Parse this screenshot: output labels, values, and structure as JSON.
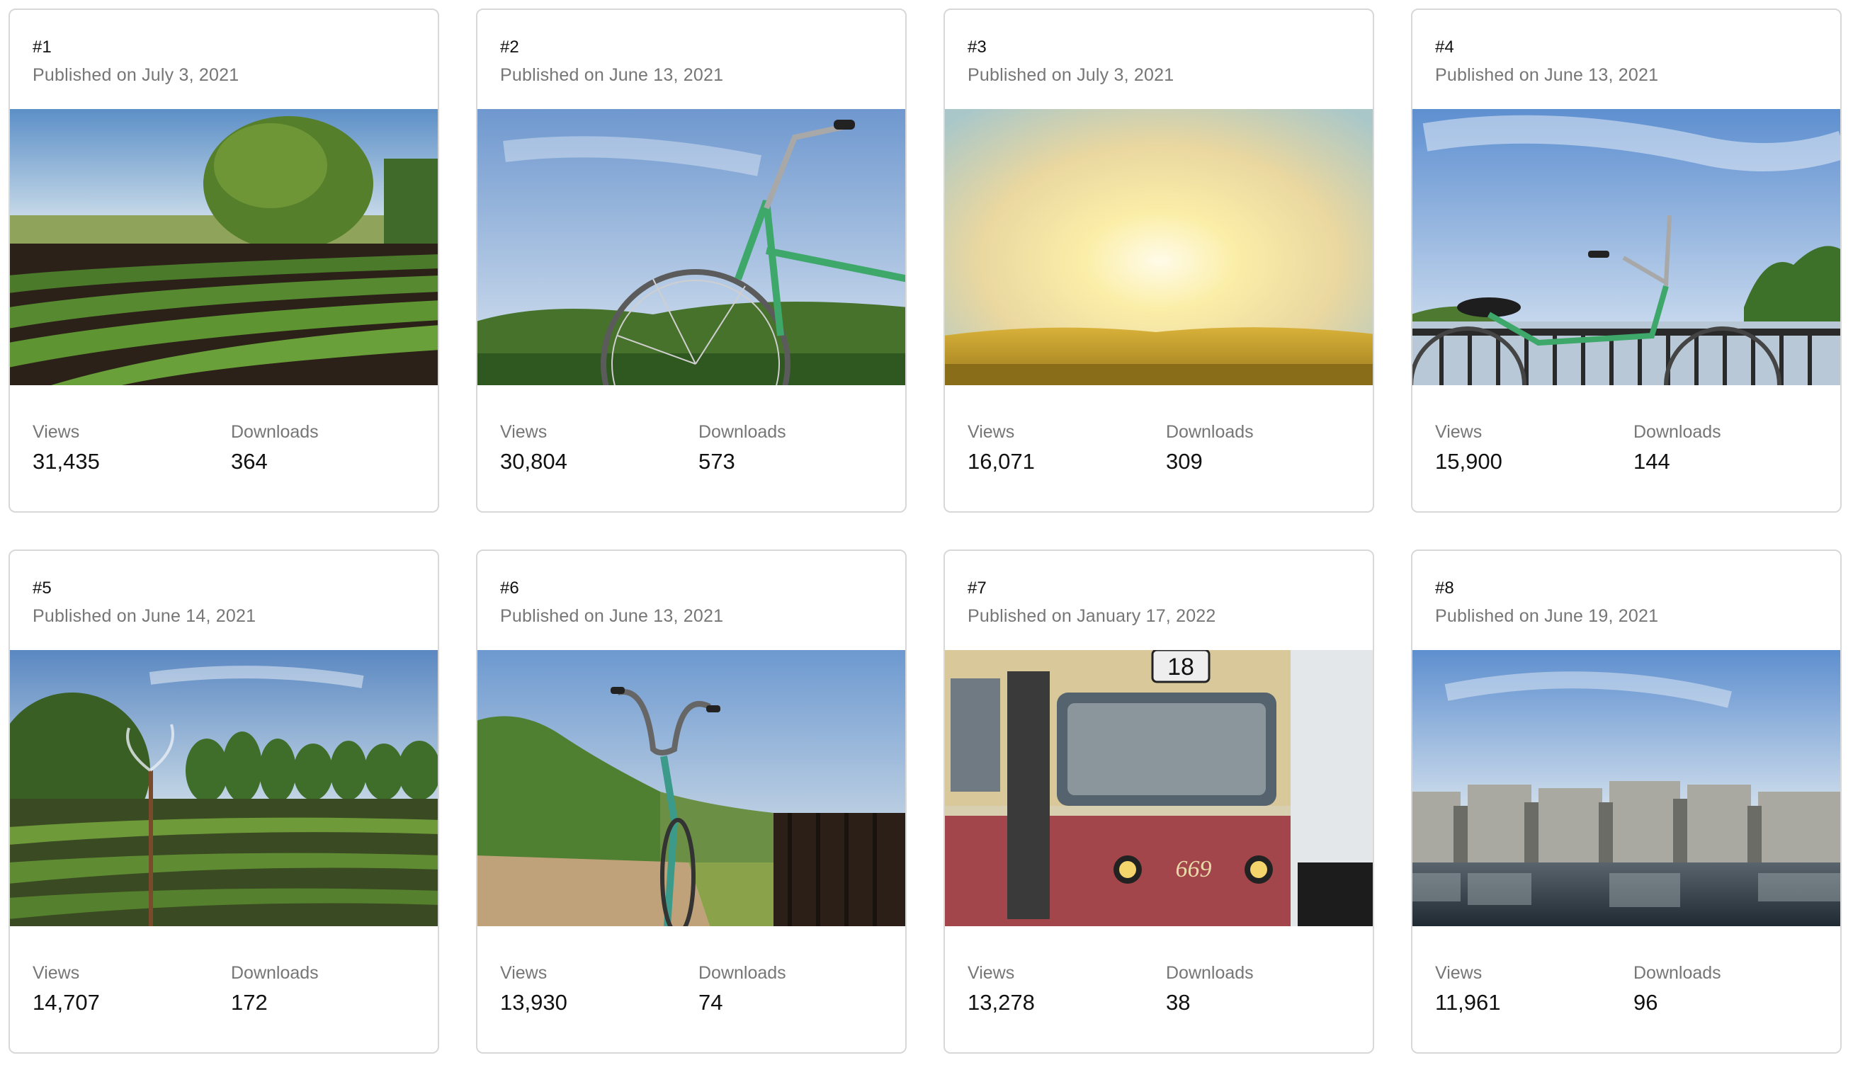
{
  "cards": [
    {
      "rank": "#1",
      "published": "Published on July 3, 2021",
      "views_label": "Views",
      "views": "31,435",
      "downloads_label": "Downloads",
      "downloads": "364",
      "photo": "tree-and-potato-field"
    },
    {
      "rank": "#2",
      "published": "Published on June 13, 2021",
      "views_label": "Views",
      "views": "30,804",
      "downloads_label": "Downloads",
      "downloads": "573",
      "photo": "green-bicycle-front"
    },
    {
      "rank": "#3",
      "published": "Published on July 3, 2021",
      "views_label": "Views",
      "views": "16,071",
      "downloads_label": "Downloads",
      "downloads": "309",
      "photo": "sunset-meadow"
    },
    {
      "rank": "#4",
      "published": "Published on June 13, 2021",
      "views_label": "Views",
      "views": "15,900",
      "downloads_label": "Downloads",
      "downloads": "144",
      "photo": "bicycle-by-railing"
    },
    {
      "rank": "#5",
      "published": "Published on June 14, 2021",
      "views_label": "Views",
      "views": "14,707",
      "downloads_label": "Downloads",
      "downloads": "172",
      "photo": "field-with-sprinkler"
    },
    {
      "rank": "#6",
      "published": "Published on June 13, 2021",
      "views_label": "Views",
      "views": "13,930",
      "downloads_label": "Downloads",
      "downloads": "74",
      "photo": "bicycle-on-dirt-road"
    },
    {
      "rank": "#7",
      "published": "Published on January 17, 2022",
      "views_label": "Views",
      "views": "13,278",
      "downloads_label": "Downloads",
      "downloads": "38",
      "photo": "tram-route-18"
    },
    {
      "rank": "#8",
      "published": "Published on June 19, 2021",
      "views_label": "Views",
      "views": "11,961",
      "downloads_label": "Downloads",
      "downloads": "96",
      "photo": "concrete-dam-on-river"
    }
  ],
  "tram_route_sign": "18",
  "tram_number": "669",
  "colors": {
    "card_border": "#d8d8d8",
    "muted_text": "#767676",
    "primary_text": "#111111"
  }
}
